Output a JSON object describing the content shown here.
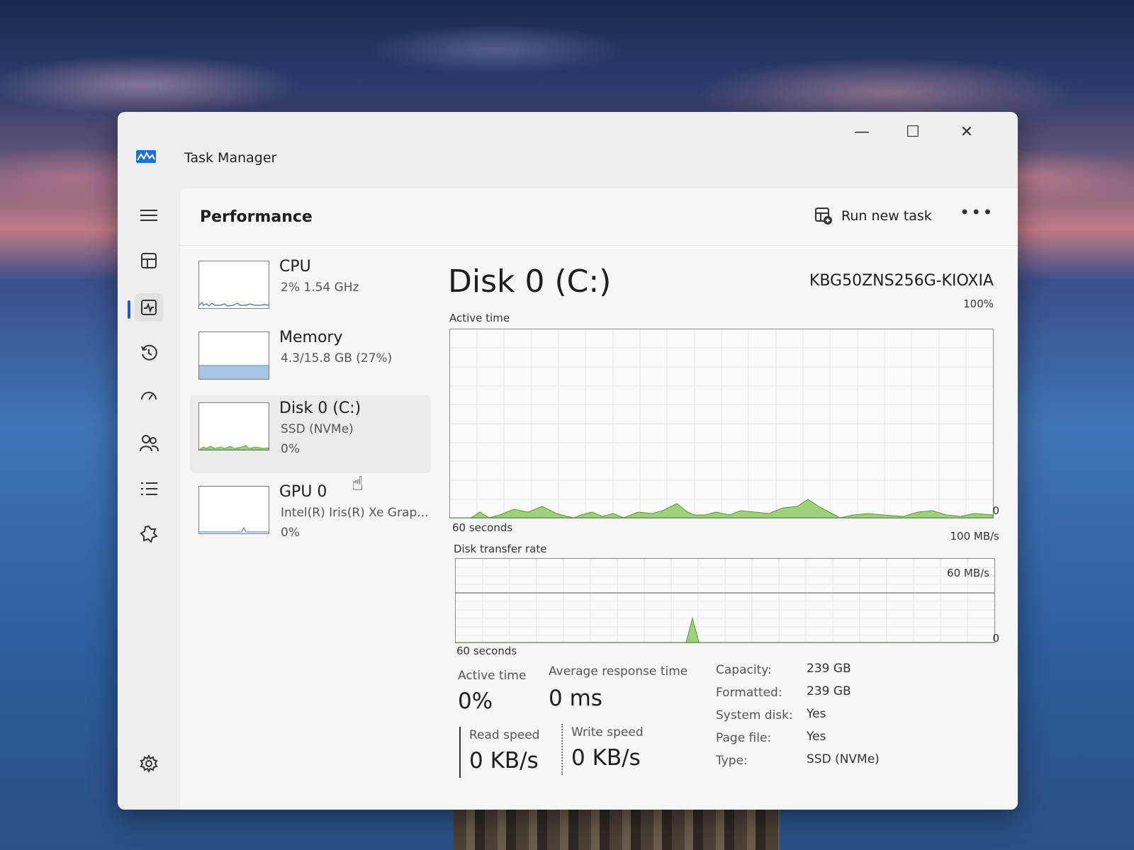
{
  "window": {
    "title": "Task Manager",
    "minimize_glyph": "—",
    "maximize_glyph": "☐",
    "close_glyph": "✕"
  },
  "nav": {
    "items": [
      {
        "name": "hamburger-menu-icon"
      },
      {
        "name": "processes-icon"
      },
      {
        "name": "performance-icon",
        "active": true
      },
      {
        "name": "app-history-icon"
      },
      {
        "name": "startup-apps-icon"
      },
      {
        "name": "users-icon"
      },
      {
        "name": "details-icon"
      },
      {
        "name": "services-icon"
      },
      {
        "name": "settings-icon"
      }
    ]
  },
  "header": {
    "title": "Performance",
    "run_new_task": "Run new task",
    "more": "•••"
  },
  "sidebar": {
    "items": [
      {
        "name": "CPU",
        "line1": "2%  1.54 GHz",
        "line2": ""
      },
      {
        "name": "Memory",
        "line1": "4.3/15.8 GB (27%)",
        "line2": ""
      },
      {
        "name": "Disk 0 (C:)",
        "line1": "SSD (NVMe)",
        "line2": "0%"
      },
      {
        "name": "GPU 0",
        "line1": "Intel(R) Iris(R) Xe Grap...",
        "line2": "0%"
      }
    ]
  },
  "detail": {
    "title": "Disk 0 (C:)",
    "model": "KBG50ZNS256G-KIOXIA",
    "active_time_graph": {
      "label": "Active time",
      "max_label": "100%",
      "min_label": "0",
      "time_label": "60 seconds"
    },
    "transfer_graph": {
      "label": "Disk transfer rate",
      "max_label": "100 MB/s",
      "mid_label": "60 MB/s",
      "min_label": "0",
      "time_label": "60 seconds"
    },
    "stats": {
      "active_time_label": "Active time",
      "active_time_value": "0%",
      "avg_response_label": "Average response time",
      "avg_response_value": "0 ms",
      "read_speed_label": "Read speed",
      "read_speed_value": "0 KB/s",
      "write_speed_label": "Write speed",
      "write_speed_value": "0 KB/s"
    },
    "properties": [
      {
        "key": "Capacity:",
        "value": "239 GB"
      },
      {
        "key": "Formatted:",
        "value": "239 GB"
      },
      {
        "key": "System disk:",
        "value": "Yes"
      },
      {
        "key": "Page file:",
        "value": "Yes"
      },
      {
        "key": "Type:",
        "value": "SSD (NVMe)"
      }
    ]
  },
  "colors": {
    "disk_fill": "#9fd17a",
    "disk_line": "#4f9a2a",
    "memory_fill": "#a9c4e4",
    "cpu_line": "#2f6fb0",
    "accent": "#1a5fb4"
  }
}
